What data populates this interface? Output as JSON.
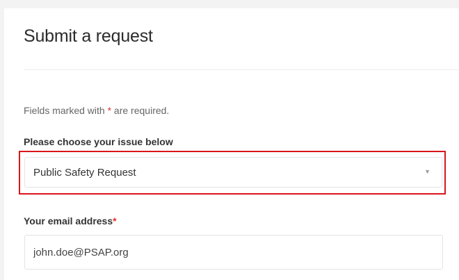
{
  "page": {
    "title": "Submit a request",
    "required_note_prefix": "Fields marked with ",
    "required_note_star": "*",
    "required_note_suffix": " are required."
  },
  "form": {
    "issue": {
      "label": "Please choose your issue below",
      "selected": "Public Safety Request",
      "caret": "▼"
    },
    "email": {
      "label": "Your email address",
      "required_star": "*",
      "value": "john.doe@PSAP.org"
    }
  },
  "colors": {
    "required_star": "#e0312b",
    "highlight_border": "#d9151b"
  },
  "icons": {
    "select_caret": "chevron-down-icon"
  }
}
